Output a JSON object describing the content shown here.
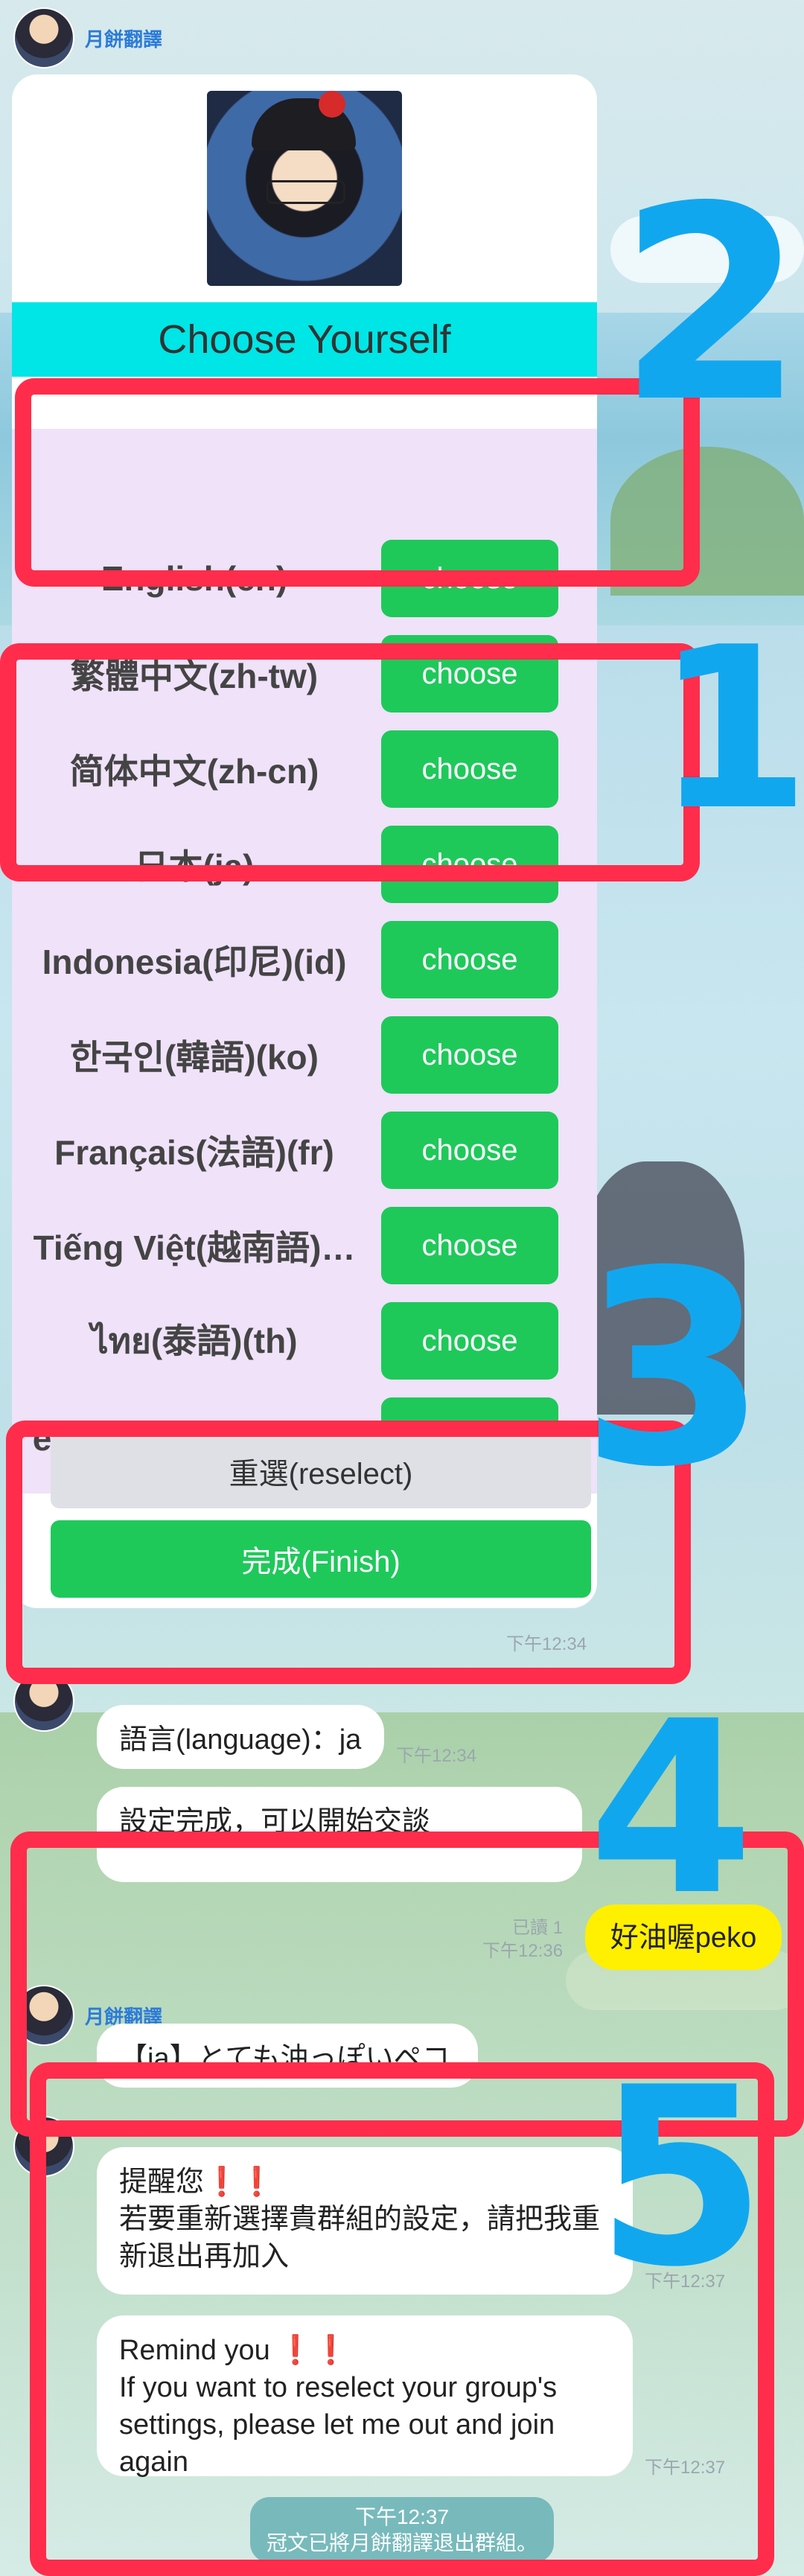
{
  "chat": {
    "sender_name": "月餅翻譯",
    "card": {
      "title": "Choose Yourself",
      "choose_label": "choose",
      "languages": [
        "English(en)",
        "繁體中文(zh-tw)",
        "简体中文(zh-cn)",
        "日本(ja)",
        "Indonesia(印尼)(id)",
        "한국인(韓語)(ko)",
        "Français(法語)(fr)",
        "Tiếng Việt(越南語)…",
        "ไทย(泰語)(th)",
        "español(西班牙語)…"
      ],
      "reselect_label": "重選(reselect)",
      "finish_label": "完成(Finish)",
      "time": "下午12:34"
    },
    "messages": {
      "language_set": "語言(language)：ja",
      "language_set_time": "下午12:34",
      "setup_done": "設定完成，可以開始交談",
      "user_msg": "好油喔peko",
      "read_time": "已讀 1\n下午12:36",
      "translation": "【ja】とても油っぽいペコ",
      "remind_zh": "提醒您❗❗\n若要重新選擇貴群組的設定，請把我重新退出再加入",
      "remind_zh_time": "下午12:37",
      "remind_en": "Remind you ❗❗\nIf you want to reselect your group's settings, please let me out and join again",
      "remind_en_time": "下午12:37",
      "system_time": "下午12:37",
      "system_text": "冠文已將月餅翻譯退出群組。"
    }
  },
  "annotations": {
    "color_box": "#ff2d4b",
    "color_number": "#11a7ef",
    "numbers": [
      "2",
      "1",
      "3",
      "4",
      "5"
    ]
  }
}
